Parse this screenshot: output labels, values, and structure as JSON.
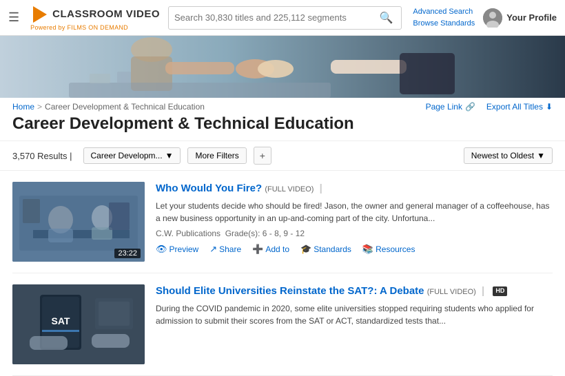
{
  "header": {
    "menu_icon": "☰",
    "logo_text": "CLASSROOM VIDEO",
    "logo_sub": "Powered by FILMS ON DEMAND",
    "search_placeholder": "Search 30,830 titles and 225,112 segments",
    "advanced_search": "Advanced Search",
    "browse_standards": "Browse Standards",
    "user_name": "Your Profile"
  },
  "breadcrumb": {
    "home": "Home",
    "separator": ">",
    "current": "Career Development & Technical Education"
  },
  "page_actions": {
    "page_link": "Page Link",
    "export_all": "Export All Titles"
  },
  "page_title": "Career Development & Technical Education",
  "filters": {
    "results_count": "3,570 Results",
    "active_filter": "Career Developm...",
    "more_filters": "More Filters",
    "add_icon": "+",
    "sort": "Newest to Oldest"
  },
  "results": [
    {
      "title": "Who Would You Fire?",
      "title_tag": "FULL VIDEO",
      "pipe": "|",
      "duration": "23:22",
      "description": "Let your students decide who should be fired! Jason, the owner and general manager of a coffeehouse, has a new business opportunity in an up-and-coming part of the city. Unfortuna...",
      "publisher": "C.W. Publications",
      "grades": "Grade(s): 6 - 8, 9 - 12",
      "actions": [
        {
          "icon": "👁",
          "label": "Preview"
        },
        {
          "icon": "↗",
          "label": "Share"
        },
        {
          "icon": "➕",
          "label": "Add to"
        },
        {
          "icon": "🎓",
          "label": "Standards"
        },
        {
          "icon": "📚",
          "label": "Resources"
        }
      ],
      "hd": false
    },
    {
      "title": "Should Elite Universities Reinstate the SAT?: A Debate",
      "title_tag": "FULL VIDEO",
      "pipe": "|",
      "hd": true,
      "description": "During the COVID pandemic in 2020, some elite universities stopped requiring students who applied for admission to submit their scores from the SAT or ACT, standardized tests that...",
      "publisher": "",
      "grades": "",
      "actions": [],
      "duration": ""
    }
  ]
}
